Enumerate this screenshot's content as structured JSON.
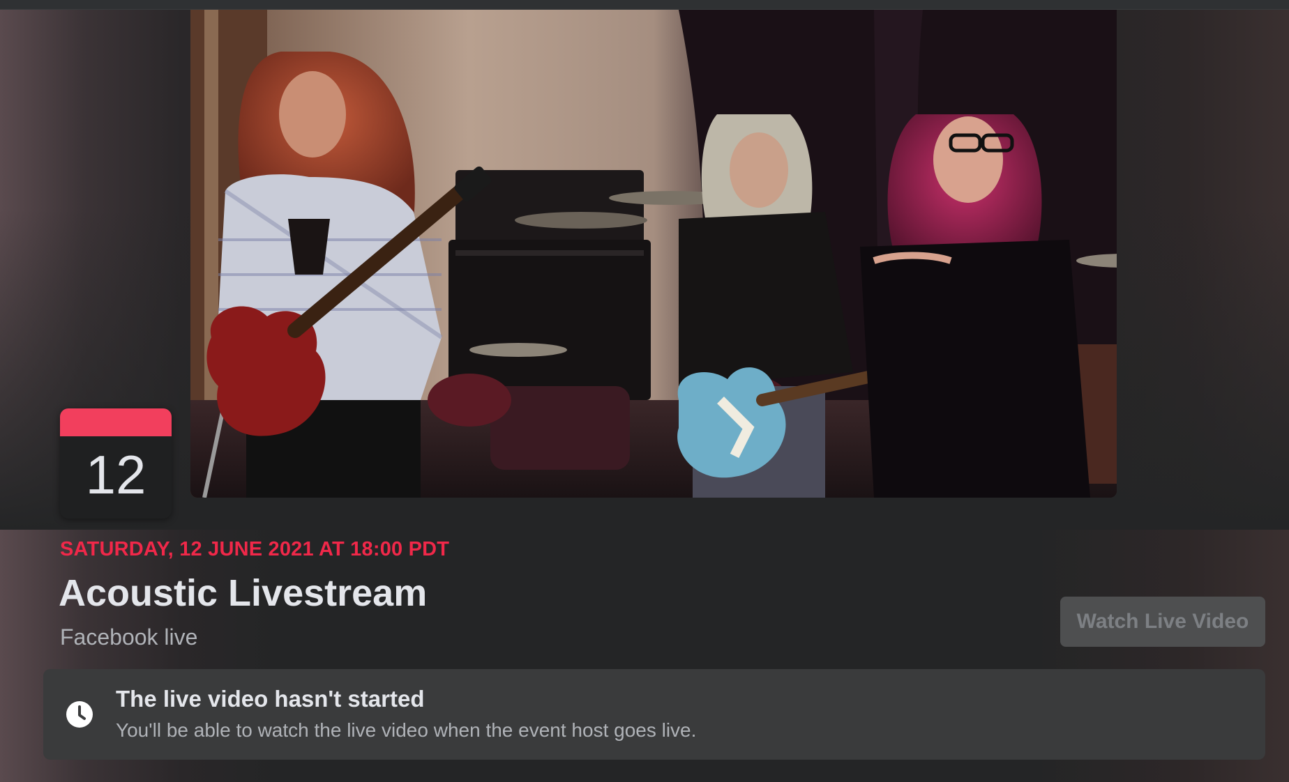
{
  "event": {
    "date_badge_day": "12",
    "date_line": "SATURDAY, 12 JUNE 2021 AT 18:00 PDT",
    "title": "Acoustic Livestream",
    "location": "Facebook live",
    "watch_button_label": "Watch Live Video"
  },
  "notice": {
    "heading": "The live video hasn't started",
    "body": "You'll be able to watch the live video when the event host goes live."
  },
  "icons": {
    "notice_icon": "clock-icon"
  },
  "colors": {
    "accent": "#f02849",
    "badge_band": "#f23f5d",
    "background": "#242526",
    "card": "#3a3b3c",
    "button_disabled": "#4e4f50"
  }
}
